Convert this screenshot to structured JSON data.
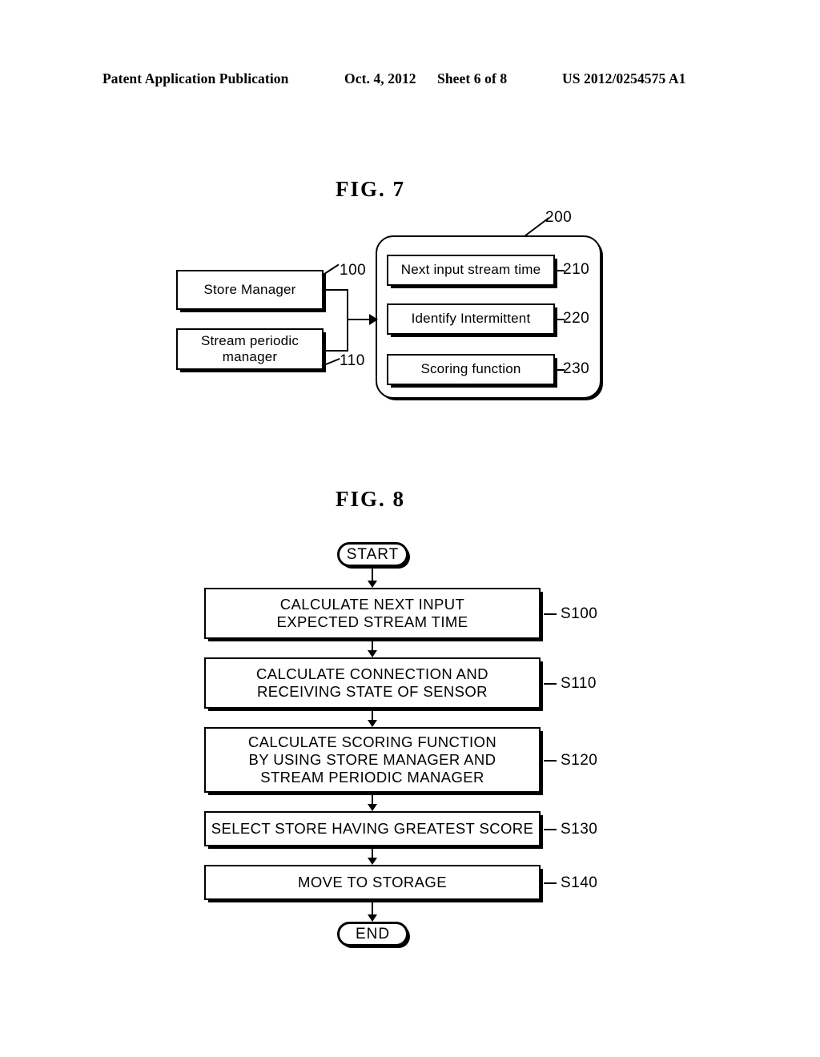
{
  "header": {
    "publication": "Patent Application Publication",
    "date": "Oct. 4, 2012",
    "sheet": "Sheet 6 of 8",
    "number": "US 2012/0254575 A1"
  },
  "figure7": {
    "title": "FIG.  7",
    "modules": [
      {
        "label": "Store Manager",
        "ref": "100"
      },
      {
        "label": "Stream periodic\nmanager",
        "ref": "110"
      }
    ],
    "container": {
      "ref": "200"
    },
    "functions": [
      {
        "label": "Next input stream time",
        "ref": "210"
      },
      {
        "label": "Identify Intermittent",
        "ref": "220"
      },
      {
        "label": "Scoring function",
        "ref": "230"
      }
    ]
  },
  "figure8": {
    "title": "FIG.  8",
    "start_label": "START",
    "end_label": "END",
    "steps": [
      {
        "label": "CALCULATE NEXT INPUT\nEXPECTED STREAM TIME",
        "ref": "S100"
      },
      {
        "label": "CALCULATE CONNECTION AND\nRECEIVING STATE OF SENSOR",
        "ref": "S110"
      },
      {
        "label": "CALCULATE SCORING FUNCTION\nBY USING STORE MANAGER AND\nSTREAM PERIODIC MANAGER",
        "ref": "S120"
      },
      {
        "label": "SELECT STORE HAVING GREATEST SCORE",
        "ref": "S130"
      },
      {
        "label": "MOVE TO STORAGE",
        "ref": "S140"
      }
    ]
  }
}
